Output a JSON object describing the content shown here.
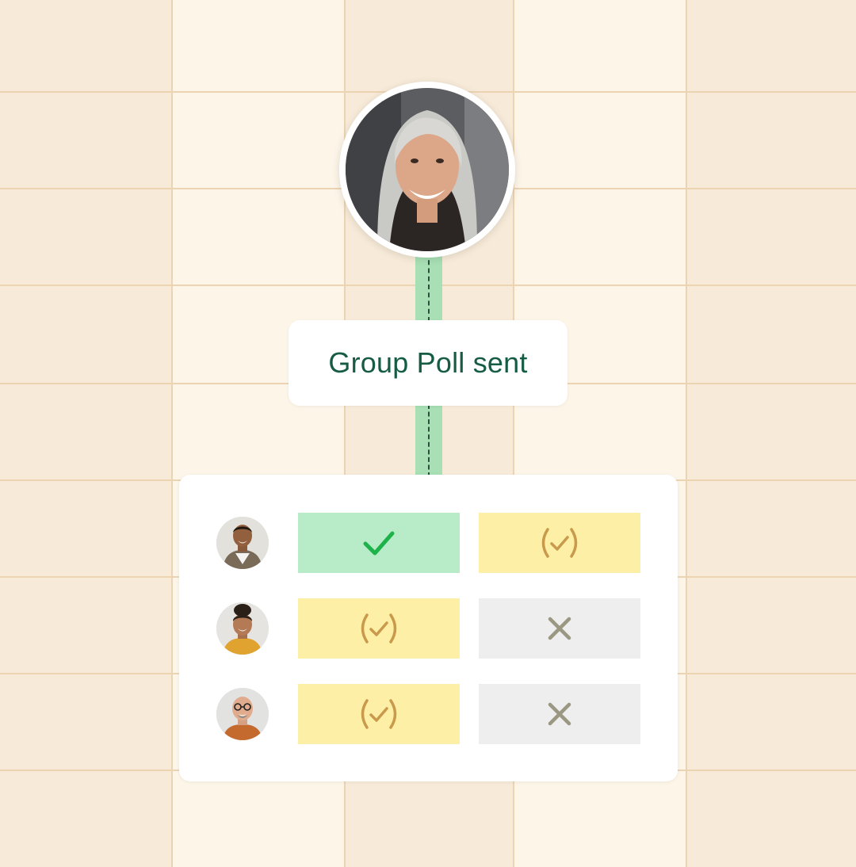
{
  "poll": {
    "status_label": "Group Poll sent",
    "organizer_avatar": "organizer-photo",
    "responses": [
      {
        "participant": "participant-1-photo",
        "answers": [
          "yes",
          "maybe"
        ]
      },
      {
        "participant": "participant-2-photo",
        "answers": [
          "maybe",
          "no"
        ]
      },
      {
        "participant": "participant-3-photo",
        "answers": [
          "maybe",
          "no"
        ]
      }
    ]
  },
  "icons": {
    "yes": "checkmark-icon",
    "maybe": "parenthesized-check-icon",
    "no": "x-mark-icon"
  },
  "colors": {
    "background": "#f7ead8",
    "connector": "#a8dfb4",
    "status_text": "#165c45",
    "yes_fill": "#b8ebc8",
    "yes_icon": "#1db34a",
    "maybe_fill": "#fdf0a6",
    "maybe_icon": "#c99a4c",
    "no_fill": "#eeeeee",
    "no_icon": "#9a9882"
  }
}
